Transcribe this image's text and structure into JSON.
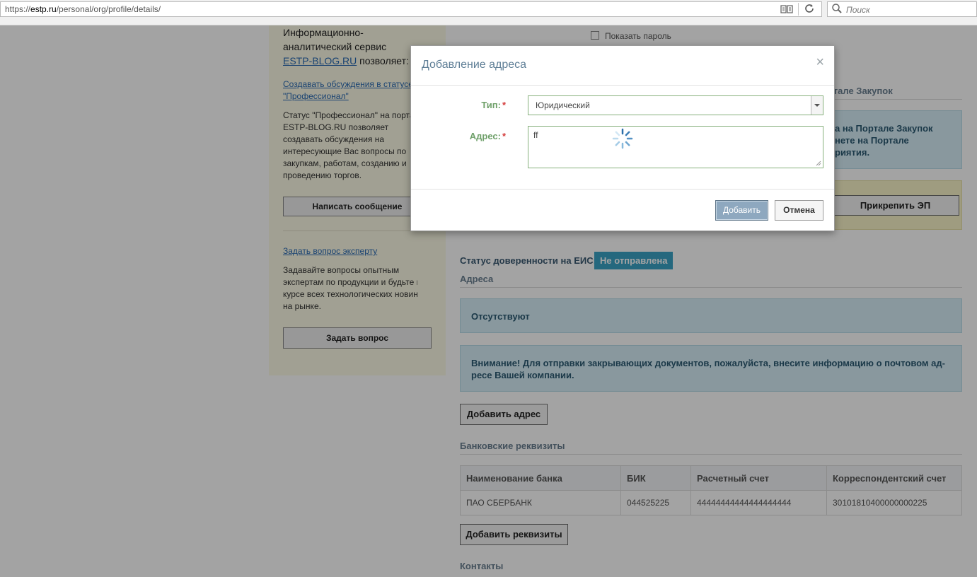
{
  "browser": {
    "url_prefix": "https://",
    "url_domain": "estp.ru",
    "url_path": "/personal/org/profile/details/",
    "search_placeholder": "Поиск",
    "icons": [
      "reader-view-icon",
      "reload-icon",
      "search-icon"
    ]
  },
  "sidebar": {
    "intro_line1": "Информационно-",
    "intro_line2": "аналитический сервис",
    "intro_link": "ESTP-BLOG.RU",
    "intro_suffix": " позволяет:",
    "pro_link_line1": "Создавать обсуждения в статусе",
    "pro_link_line2": "\"Профессионал\"",
    "pro_text": [
      "Статус \"Профессионал\" на портале",
      "ESTP-BLOG.RU позволяет",
      "создавать обсуждения на",
      "интересующие Вас вопросы по",
      "закупкам, работам, созданию и",
      "проведению торгов."
    ],
    "write_button": "Написать сообщение",
    "expert_link": "Задать вопрос эксперту",
    "expert_text": [
      "Задавайте вопросы опытным",
      "экспертам по продукции и будьте в",
      "курсе всех технологических новинок",
      "на рынке."
    ],
    "ask_button": "Задать вопрос"
  },
  "main": {
    "show_password": "Показать пароль",
    "portal_heading": "ртале Закупок",
    "portal_info": [
      "а на Портале Закупок",
      "нете на Портале",
      "риятия."
    ],
    "attach_button": "Прикрепить ЭП",
    "trust_status_label": "Статус доверенности на ЕИС:",
    "trust_status_value": "Не отправлена",
    "addresses_title": "Адреса",
    "addresses_empty": "Отсутствуют",
    "attention_line1": "Внимание! Для отправки закрывающих документов, пожалуйста, внесите информацию о почтовом ад-",
    "attention_line2": "ресе Вашей компании.",
    "add_address_button": "Добавить адрес",
    "bank_title": "Банковские реквизиты",
    "bank_columns": [
      "Наименование банка",
      "БИК",
      "Расчетный счет",
      "Корреспондентский счет"
    ],
    "bank_rows": [
      [
        "ПАО СБЕРБАНК",
        "044525225",
        "44444444444444444444",
        "30101810400000000225"
      ]
    ],
    "add_requisites_button": "Добавить реквизиты",
    "contacts_title": "Контакты"
  },
  "modal": {
    "title": "Добавление адреса",
    "close_symbol": "×",
    "type_label": "Тип:",
    "required_mark": "*",
    "type_value": "Юридический",
    "address_label": "Адрес:",
    "address_value": "ff",
    "add_button": "Добавить",
    "cancel_button": "Отмена"
  },
  "colors": {
    "overlay": "rgba(0,0,0,0.36)",
    "label_green": "#6fa06a",
    "info_blue": "#d7eef7",
    "status_badge": "#3aa3c6",
    "sidebar_bg": "#fcfbe6"
  }
}
